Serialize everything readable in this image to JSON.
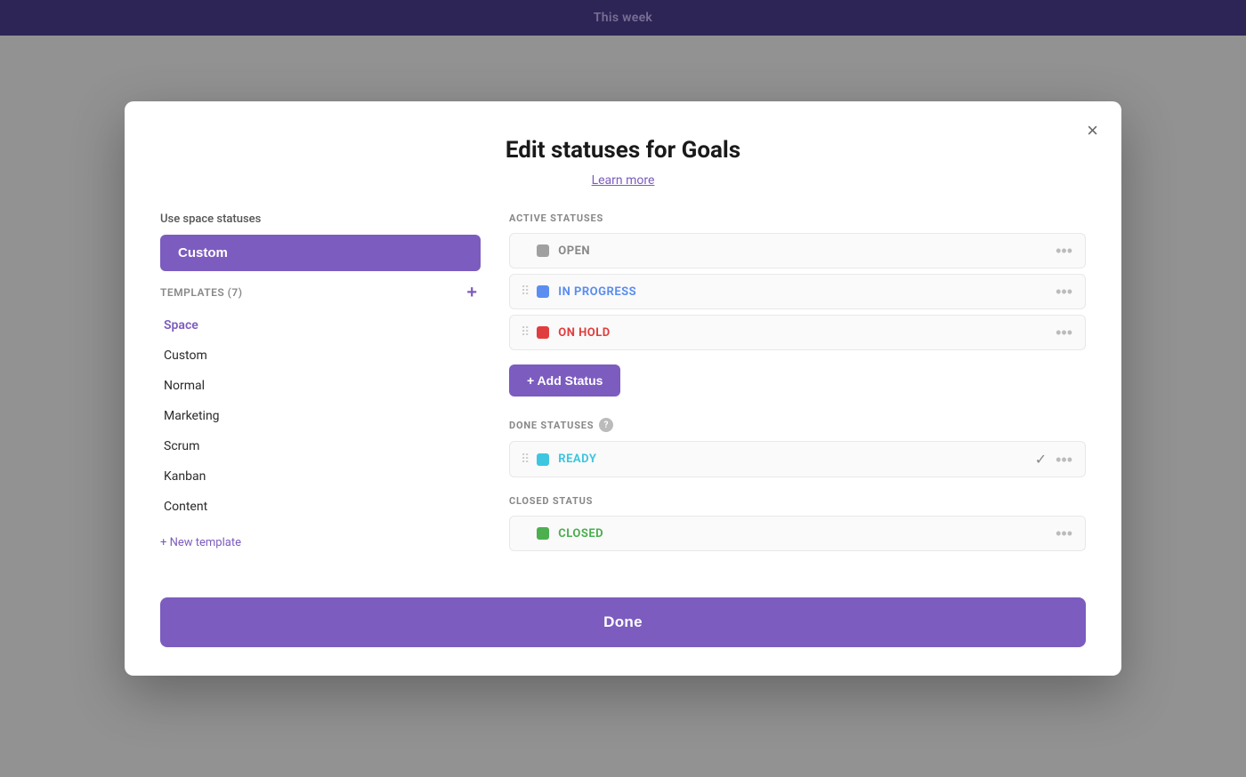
{
  "app": {
    "topbar_title": "This week"
  },
  "modal": {
    "title": "Edit statuses for Goals",
    "learn_more": "Learn more",
    "close_label": "×",
    "left": {
      "use_space_label": "Use space statuses",
      "selected_template": "Custom",
      "templates_label": "TEMPLATES (7)",
      "templates_add_icon": "+",
      "template_items": [
        {
          "label": "Space",
          "is_space": true
        },
        {
          "label": "Custom",
          "is_space": false
        },
        {
          "label": "Normal",
          "is_space": false
        },
        {
          "label": "Marketing",
          "is_space": false
        },
        {
          "label": "Scrum",
          "is_space": false
        },
        {
          "label": "Kanban",
          "is_space": false
        },
        {
          "label": "Content",
          "is_space": false
        }
      ],
      "new_template_label": "+ New template"
    },
    "right": {
      "active_statuses_label": "ACTIVE STATUSES",
      "active_statuses": [
        {
          "name": "OPEN",
          "color_class": "gray",
          "text_class": "gray-text",
          "has_drag": false
        },
        {
          "name": "IN PROGRESS",
          "color_class": "blue",
          "text_class": "blue-text",
          "has_drag": true
        },
        {
          "name": "ON HOLD",
          "color_class": "red",
          "text_class": "red-text",
          "has_drag": true
        }
      ],
      "add_status_label": "+ Add Status",
      "done_statuses_label": "DONE STATUSES",
      "done_statuses": [
        {
          "name": "READY",
          "color_class": "cyan",
          "text_class": "cyan-text",
          "has_check": true
        }
      ],
      "closed_status_label": "CLOSED STATUS",
      "closed_statuses": [
        {
          "name": "CLOSED",
          "color_class": "green",
          "text_class": "green-text",
          "has_check": false
        }
      ]
    },
    "done_button_label": "Done"
  }
}
